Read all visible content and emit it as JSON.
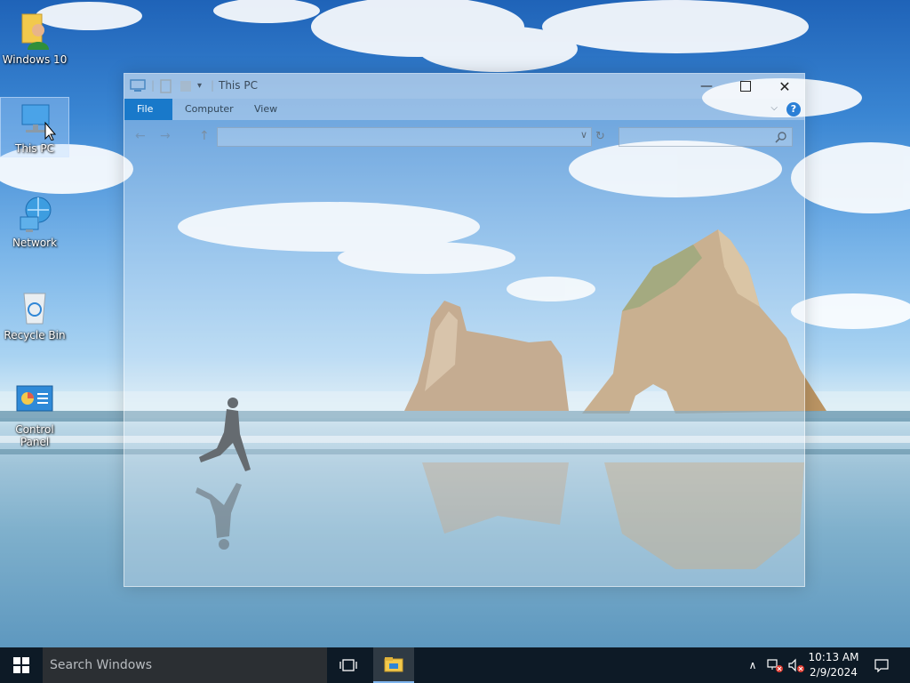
{
  "desktop": {
    "icons": [
      {
        "label": "Windows 10"
      },
      {
        "label": "This PC"
      },
      {
        "label": "Network"
      },
      {
        "label": "Recycle Bin"
      },
      {
        "label": "Control Panel"
      }
    ]
  },
  "explorer": {
    "title": "This PC",
    "tabs": [
      {
        "label": "File",
        "active": true
      },
      {
        "label": "Computer",
        "active": false
      },
      {
        "label": "View",
        "active": false
      }
    ],
    "address_value": "",
    "search_placeholder": "",
    "help_glyph": "?"
  },
  "taskbar": {
    "search_placeholder": "Search Windows",
    "clock": {
      "time": "10:13 AM",
      "date": "2/9/2024"
    }
  },
  "colors": {
    "accent": "#1979ca",
    "taskbar": "#0d1a26",
    "search_bg": "#2b2f33"
  }
}
